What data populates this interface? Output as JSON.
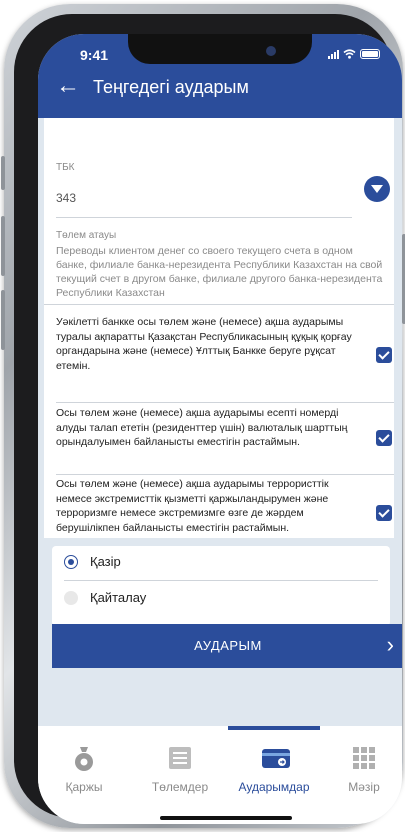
{
  "status_bar": {
    "time": "9:41"
  },
  "header": {
    "back_icon": "arrow-left-icon",
    "title": "Теңгедегі аударым"
  },
  "form": {
    "tbk_label": "ТБК",
    "tbk_value": "343",
    "payment_label": "Төлем атауы",
    "payment_value": "Переводы клиентом денег со своего текущего счета в одном банке, филиале банка-нерезидента Республики Казахстан на свой текущий счет в  другом банке, филиале другого банка-нерезидента Республики Казахстан"
  },
  "consents": [
    {
      "text": "Уәкілетті банкке осы төлем және (немесе) ақша аударымы туралы ақпаратты Қазақстан Республикасының құқық қорғау органдарына және (немесе) Ұлттық Банкке беруге рұқсат етемін.",
      "checked": true
    },
    {
      "text": "Осы төлем және (немесе) ақша аударымы есепті номерді алуды талап ететін (резиденттер үшін) валюталық шарттың орындалуымен байланысты еместігін растаймын.",
      "checked": true
    },
    {
      "text": "Осы төлем және (немесе) ақша аударымы террористтік немесе экстремисттік қызметті қаржыландырумен және терроризмге немесе экстремизмге өзге де жәрдем берушілікпен байланысты еместігін растаймын.",
      "checked": true
    }
  ],
  "schedule": {
    "options": [
      {
        "label": "Қазір",
        "selected": true
      },
      {
        "label": "Қайталау",
        "selected": false
      }
    ]
  },
  "submit": {
    "label": "АУДАРЫМ"
  },
  "tabbar": {
    "tabs": [
      {
        "label": "Қаржы",
        "icon": "money-bag-icon",
        "active": false
      },
      {
        "label": "Төлемдер",
        "icon": "list-icon",
        "active": false
      },
      {
        "label": "Аударымдар",
        "icon": "card-transfer-icon",
        "active": true
      },
      {
        "label": "Мәзір",
        "icon": "grid-icon",
        "active": false
      }
    ]
  },
  "colors": {
    "primary": "#2b4d9b",
    "background": "#dfe7ef"
  }
}
